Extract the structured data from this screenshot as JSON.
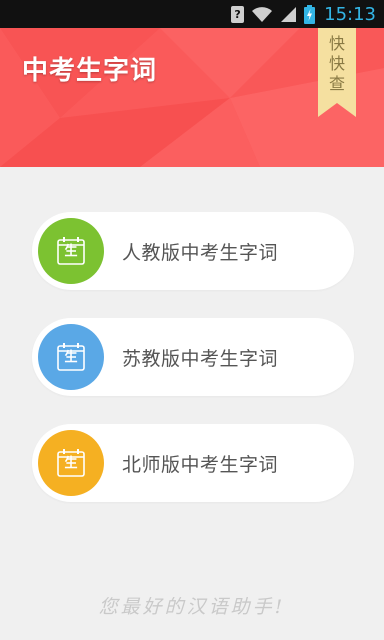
{
  "status_bar": {
    "time": "15:13",
    "sim_symbol": "?",
    "icons": [
      "sim-unknown-icon",
      "wifi-icon",
      "signal-icon",
      "battery-charging-icon"
    ]
  },
  "header": {
    "title": "中考生字词",
    "ribbon_chars": [
      "快",
      "快",
      "查"
    ],
    "colors": {
      "background": "#fa5a5a",
      "ribbon": "#f5e0a0"
    }
  },
  "menu": {
    "items": [
      {
        "label": "人教版中考生字词",
        "icon_char": "生",
        "color": "#7cc231"
      },
      {
        "label": "苏教版中考生字词",
        "icon_char": "生",
        "color": "#5aa8e6"
      },
      {
        "label": "北师版中考生字词",
        "icon_char": "生",
        "color": "#f5b022"
      }
    ]
  },
  "footer": {
    "slogan": "您最好的汉语助手!"
  }
}
